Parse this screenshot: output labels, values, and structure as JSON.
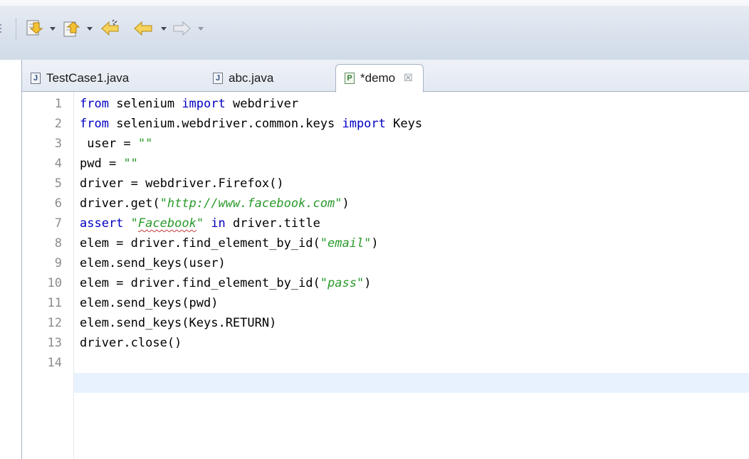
{
  "toolbar": {
    "buttons": [
      {
        "name": "next-annotation-icon",
        "dropdown": true
      },
      {
        "name": "previous-annotation-icon",
        "dropdown": true
      },
      {
        "name": "last-edit-location-icon"
      },
      {
        "name": "back-icon",
        "dropdown": true
      },
      {
        "name": "forward-icon",
        "dropdown": true,
        "disabled": true
      }
    ]
  },
  "tabs": [
    {
      "label": "TestCase1.java",
      "icon": "J",
      "active": false
    },
    {
      "label": "abc.java",
      "icon": "J",
      "active": false
    },
    {
      "label": "*demo",
      "icon": "P",
      "active": true,
      "close": "☒"
    }
  ],
  "editor": {
    "current_line": 14,
    "lines": [
      {
        "num": "1",
        "text": "from selenium import webdriver"
      },
      {
        "num": "2",
        "text": "from selenium.webdriver.common.keys import Keys"
      },
      {
        "num": "3",
        "text": " user = \"\""
      },
      {
        "num": "4",
        "text": "pwd = \"\""
      },
      {
        "num": "5",
        "text": "driver = webdriver.Firefox()"
      },
      {
        "num": "6",
        "text": "driver.get(\"http://www.facebook.com\")"
      },
      {
        "num": "7",
        "text": "assert \"Facebook\" in driver.title"
      },
      {
        "num": "8",
        "text": "elem = driver.find_element_by_id(\"email\")"
      },
      {
        "num": "9",
        "text": "elem.send_keys(user)"
      },
      {
        "num": "10",
        "text": "elem = driver.find_element_by_id(\"pass\")"
      },
      {
        "num": "11",
        "text": "elem.send_keys(pwd)"
      },
      {
        "num": "12",
        "text": "elem.send_keys(Keys.RETURN)"
      },
      {
        "num": "13",
        "text": "driver.close()"
      },
      {
        "num": "14",
        "text": ""
      }
    ]
  },
  "colors": {
    "keyword": "#0000c0",
    "string": "#2a9a2a",
    "line_number": "#8c8c8c",
    "current_line": "#e8f2fe"
  }
}
